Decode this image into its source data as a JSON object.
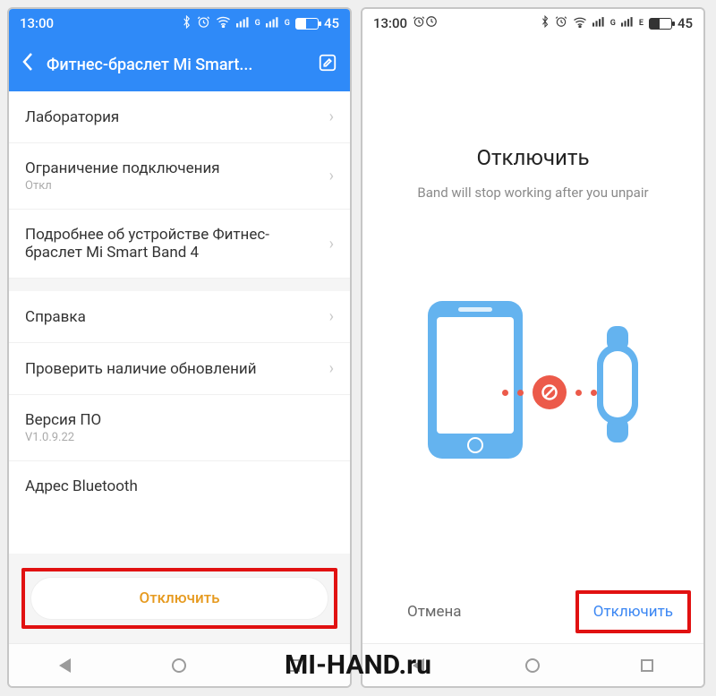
{
  "watermark": "MI-HAND.ru",
  "left": {
    "status": {
      "time": "13:00",
      "battery": "45"
    },
    "header_title": "Фитнес-браслет Mi Smart...",
    "rows": {
      "lab": "Лаборатория",
      "conn_limit": "Ограничение подключения",
      "conn_limit_sub": "Откл",
      "about": "Подробнее об устройстве Фитнес-браслет Mi Smart Band 4",
      "help": "Справка",
      "check_upd": "Проверить наличие обновлений",
      "fw": "Версия ПО",
      "fw_val": "V1.0.9.22",
      "bt": "Адрес Bluetooth"
    },
    "disconnect_btn": "Отключить"
  },
  "right": {
    "status": {
      "time": "13:00",
      "battery": "45"
    },
    "title": "Отключить",
    "subtitle": "Band will stop working after you unpair",
    "cancel": "Отмена",
    "disconnect": "Отключить"
  }
}
